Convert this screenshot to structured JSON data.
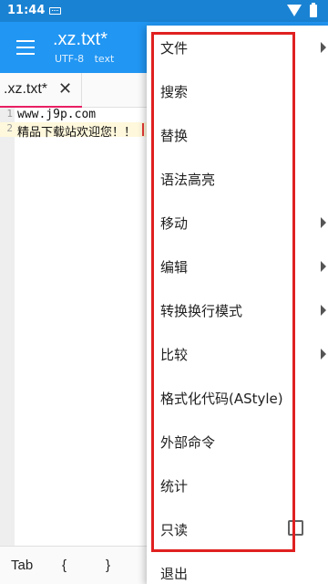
{
  "status_bar": {
    "time": "11:44"
  },
  "app_bar": {
    "title": ".xz.txt*",
    "encoding": "UTF-8",
    "mode": "text"
  },
  "tabs": [
    {
      "label": ".xz.txt*"
    }
  ],
  "editor": {
    "lines": [
      {
        "number": "1",
        "text": "www.j9p.com"
      },
      {
        "number": "2",
        "text": "精品下载站欢迎您！！"
      }
    ]
  },
  "symbol_bar": {
    "symbols": [
      "Tab",
      "{",
      "}"
    ]
  },
  "menu": {
    "items": [
      {
        "label": "文件",
        "has_submenu": true
      },
      {
        "label": "搜索",
        "has_submenu": false
      },
      {
        "label": "替换",
        "has_submenu": false
      },
      {
        "label": "语法高亮",
        "has_submenu": false
      },
      {
        "label": "移动",
        "has_submenu": true
      },
      {
        "label": "编辑",
        "has_submenu": true
      },
      {
        "label": "转换换行模式",
        "has_submenu": true
      },
      {
        "label": "比较",
        "has_submenu": true
      },
      {
        "label": "格式化代码(AStyle)",
        "has_submenu": false
      },
      {
        "label": "外部命令",
        "has_submenu": false
      },
      {
        "label": "统计",
        "has_submenu": false
      },
      {
        "label": "只读",
        "has_checkbox": true,
        "checked": false
      },
      {
        "label": "退出",
        "has_submenu": false
      }
    ]
  },
  "colors": {
    "status_bar": "#1a82d2",
    "app_bar": "#2196f3",
    "tab_underline": "#e91e63",
    "highlight_box": "#e02020"
  },
  "icons": [
    "keyboard-icon",
    "wifi-icon",
    "battery-icon",
    "menu-icon",
    "close-icon",
    "chevron-right-icon",
    "checkbox-icon"
  ]
}
